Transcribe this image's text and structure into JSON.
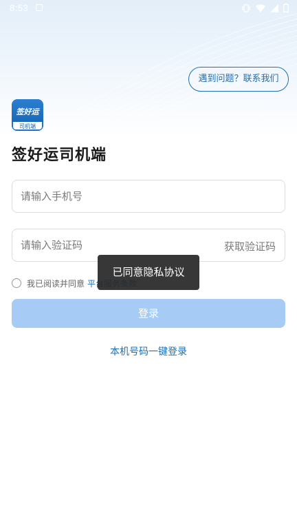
{
  "status_bar": {
    "time": "8:53"
  },
  "header": {
    "help_label": "遇到问题？联系我们"
  },
  "logo": {
    "main_text": "签好运",
    "sub_text": "司机端"
  },
  "app_title": "签好运司机端",
  "phone_input": {
    "placeholder": "请输入手机号",
    "value": ""
  },
  "code_input": {
    "placeholder": "请输入验证码",
    "value": "",
    "get_code_label": "获取验证码"
  },
  "agreement": {
    "text": "我已阅读并同意",
    "link_label": "平台服务条款",
    "checked": false
  },
  "login_label": "登录",
  "one_click_login_label": "本机号码一键登录",
  "toast": {
    "message": "已同意隐私协议"
  },
  "colors": {
    "accent": "#1e6fb5",
    "login_button_disabled": "#a6cbf5",
    "toast_background": "#282828"
  },
  "icons": [
    "notification-icon",
    "vibrate-icon",
    "wifi-icon",
    "signal-icon",
    "battery-icon",
    "radio-icon"
  ]
}
